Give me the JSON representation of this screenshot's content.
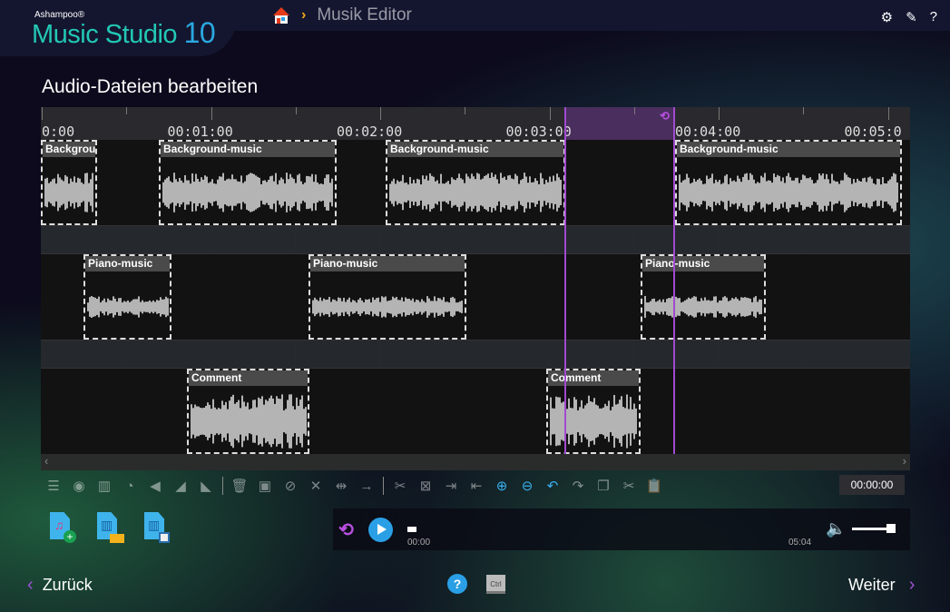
{
  "header": {
    "brand_small": "Ashampoo®",
    "brand_name": "Music Studio",
    "brand_version": "10",
    "breadcrumb": "Musik Editor",
    "icons": [
      "settings-icon",
      "edit-icon",
      "help-icon"
    ],
    "help_glyph": "?"
  },
  "page_title": "Audio-Dateien bearbeiten",
  "ruler": {
    "labels": [
      "0:00",
      "00:01:00",
      "00:02:00",
      "00:03:00",
      "00:04:00",
      "00:05:0"
    ]
  },
  "tracks": [
    {
      "name": "track-1",
      "clips": [
        {
          "label": "Backgrour"
        },
        {
          "label": "Background-music"
        },
        {
          "label": "Background-music"
        },
        {
          "label": "Background-music"
        }
      ]
    },
    {
      "name": "track-2",
      "clips": [
        {
          "label": "Piano-music"
        },
        {
          "label": "Piano-music"
        },
        {
          "label": "Piano-music"
        }
      ]
    },
    {
      "name": "track-3",
      "clips": [
        {
          "label": "Comment"
        },
        {
          "label": "Comment"
        }
      ]
    }
  ],
  "scroll": {
    "left": "‹",
    "right": "›"
  },
  "toolbar": {
    "time": "00:00:00"
  },
  "player": {
    "current": "00:00",
    "total": "05:04",
    "progress": 0,
    "volume": 0.85
  },
  "footer": {
    "back": "Zurück",
    "next": "Weiter",
    "back_arrow": "‹",
    "next_arrow": "›",
    "help": "?",
    "ctrl": "Ctrl"
  }
}
